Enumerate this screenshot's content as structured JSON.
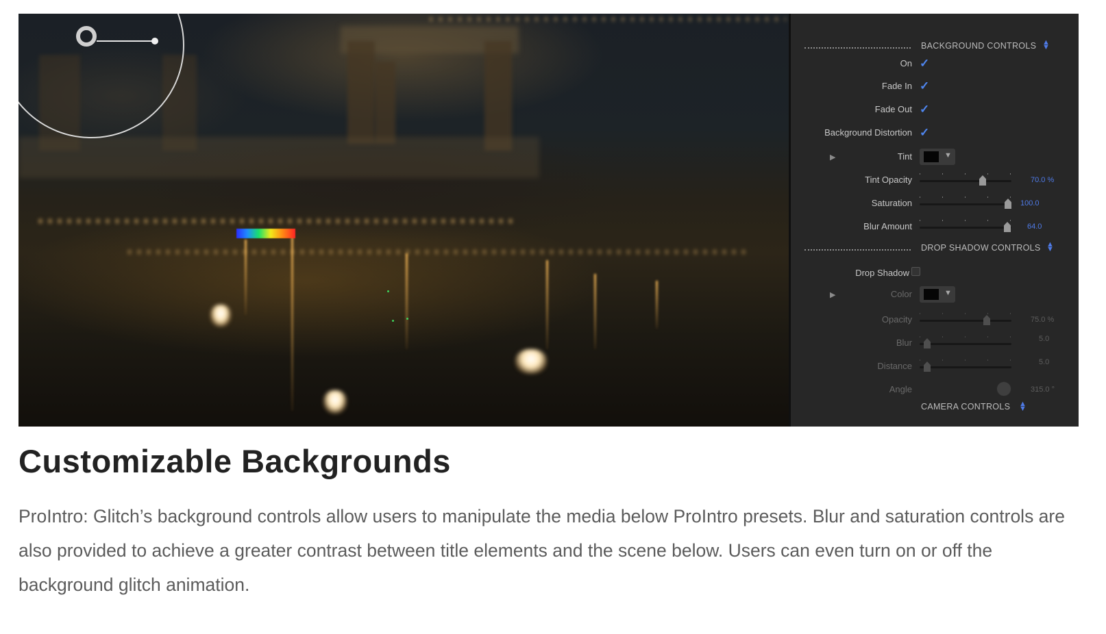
{
  "panel": {
    "background_section": {
      "title": "BACKGROUND CONTROLS",
      "on_label": "On",
      "on_checked": true,
      "fade_in_label": "Fade In",
      "fade_in_checked": true,
      "fade_out_label": "Fade Out",
      "fade_out_checked": true,
      "distortion_label": "Background Distortion",
      "distortion_checked": true,
      "tint_label": "Tint",
      "tint_color": "#050505",
      "tint_opacity_label": "Tint Opacity",
      "tint_opacity_value": "70.0 %",
      "tint_opacity_level": 0.7,
      "saturation_label": "Saturation",
      "saturation_value": "100.0",
      "saturation_level": 1.0,
      "blur_label": "Blur Amount",
      "blur_value": "64.0",
      "blur_level": 0.99
    },
    "shadow_section": {
      "title": "DROP SHADOW CONTROLS",
      "drop_shadow_label": "Drop Shadow",
      "drop_shadow_checked": false,
      "color_label": "Color",
      "color_value": "#050505",
      "opacity_label": "Opacity",
      "opacity_value": "75.0 %",
      "opacity_level": 0.75,
      "blur_label": "Blur",
      "blur_value": "5.0",
      "blur_level": 0.05,
      "distance_label": "Distance",
      "distance_value": "5.0",
      "distance_level": 0.05,
      "angle_label": "Angle",
      "angle_value": "315.0 °"
    },
    "camera_section": {
      "title": "CAMERA CONTROLS"
    },
    "accent_color": "#4f7be8",
    "icons": {
      "checkmark": "checkmark-icon",
      "stepper": "up-down-icon",
      "disclosure": "disclosure-triangle-icon",
      "dropdown": "dropdown-arrow-icon"
    }
  },
  "content": {
    "heading": "Customizable Backgrounds",
    "description": "ProIntro: Glitch’s background controls allow users to manipulate the media below ProIntro presets. Blur and saturation controls are also provided to achieve a greater contrast between title elements and the scene below. Users can even turn on or off the background glitch animation."
  }
}
